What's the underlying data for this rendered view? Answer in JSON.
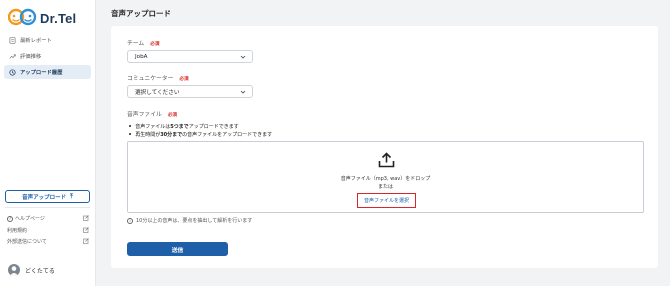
{
  "app": {
    "logo_text": "Dr.Tel"
  },
  "sidebar": {
    "items": [
      {
        "label": "最新レポート",
        "icon": "report-icon",
        "active": false
      },
      {
        "label": "評価推移",
        "icon": "trend-icon",
        "active": false
      },
      {
        "label": "アップロード履歴",
        "icon": "history-icon",
        "active": true
      }
    ],
    "upload_button": "音声アップロード",
    "links": [
      {
        "label": "ヘルプページ",
        "icon": "help-icon"
      },
      {
        "label": "利用規約",
        "icon": ""
      },
      {
        "label": "外部送信について",
        "icon": ""
      }
    ],
    "user_name": "どくたてる"
  },
  "main": {
    "title": "音声アップロード",
    "team": {
      "label": "チーム",
      "required": "必須",
      "value": "JobA"
    },
    "communicator": {
      "label": "コミュニケーター",
      "required": "必須",
      "value": "選択してください"
    },
    "audio": {
      "label": "音声ファイル",
      "required": "必須",
      "bullet1_pre": "音声ファイルは",
      "bullet1_bold": "5つまで",
      "bullet1_post": "アップロードできます",
      "bullet2_pre": "再生時間が",
      "bullet2_bold": "30分まで",
      "bullet2_post": "の音声ファイルをアップロードできます",
      "drop_text": "音声ファイル（mp3, wav）をドロップ",
      "or_text": "または",
      "select_button": "音声ファイルを選択"
    },
    "note": "10分以上の音声は、要点を抽出して解析を行います",
    "submit": "送信"
  },
  "colors": {
    "brand": "#1e5fa8",
    "required": "#d6302c",
    "highlight": "#d6282c"
  }
}
